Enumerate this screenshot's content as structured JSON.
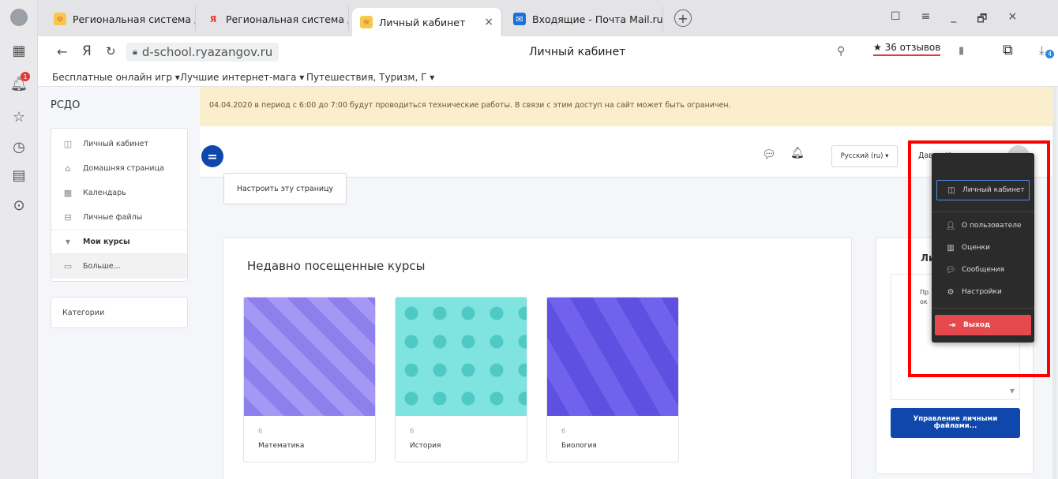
{
  "browser": {
    "tabs": [
      {
        "label": "Региональная система дис"
      },
      {
        "label": "Региональная система дис"
      },
      {
        "label": "Личный кабинет",
        "close": "×"
      },
      {
        "label": "Входящие - Почта Mail.ru"
      }
    ],
    "window_controls": [
      "☐",
      "≡",
      "_",
      "🗗",
      "×"
    ],
    "url_domain": "d-school.ryazangov.ru",
    "page_title": "Личный кабинет",
    "reviews": "★ 36 отзывов",
    "rail_badge": "1",
    "download_badge": "4",
    "bookmarks": [
      "Бесплатные онлайн игр ▾",
      "Лучшие интернет-мага ▾",
      "Путешествия, Туризм, Г ▾"
    ]
  },
  "site": {
    "brand": "РСДО",
    "notice": "04.04.2020 в период с 6:00 до 7:00 будут проводиться технические работы. В связи с этим доступ на сайт может быть ограничен.",
    "nav": [
      {
        "label": "Личный кабинет",
        "icon": "dashboard-icon"
      },
      {
        "label": "Домашняя страница",
        "icon": "home-icon"
      },
      {
        "label": "Календарь",
        "icon": "calendar-icon"
      },
      {
        "label": "Личные файлы",
        "icon": "folder-icon"
      },
      {
        "label": "Мои курсы",
        "icon": "chevron-down-icon"
      },
      {
        "label": "Больше...",
        "icon": "folder-icon"
      }
    ],
    "categories": "Категории",
    "language": "Русский (ru) ▾",
    "user_name": "Давид Конопелько",
    "customize_button": "Настроить эту страницу",
    "recent_courses_title": "Недавно посещенные курсы",
    "courses": [
      {
        "category": "6",
        "name": "Математика",
        "color": "#9b8ff0"
      },
      {
        "category": "6",
        "name": "История",
        "color": "#7fe3df"
      },
      {
        "category": "6",
        "name": "Биология",
        "color": "#6a5ce8"
      }
    ],
    "right_block_title": "Ли",
    "right_block_text": "Пр",
    "right_block_text2": "ок",
    "manage_files_button": "Управление личными файлами..."
  },
  "user_menu": {
    "items": [
      {
        "label": "Личный кабинет",
        "icon": "dashboard-icon"
      },
      {
        "label": "О пользователе",
        "icon": "user-icon"
      },
      {
        "label": "Оценки",
        "icon": "grades-icon"
      },
      {
        "label": "Сообщения",
        "icon": "messages-icon"
      },
      {
        "label": "Настройки",
        "icon": "settings-icon"
      }
    ],
    "logout": "Выход"
  },
  "colors": {
    "accent": "#0f47ad",
    "highlight": "#ff0000",
    "logout": "#e5484d"
  }
}
